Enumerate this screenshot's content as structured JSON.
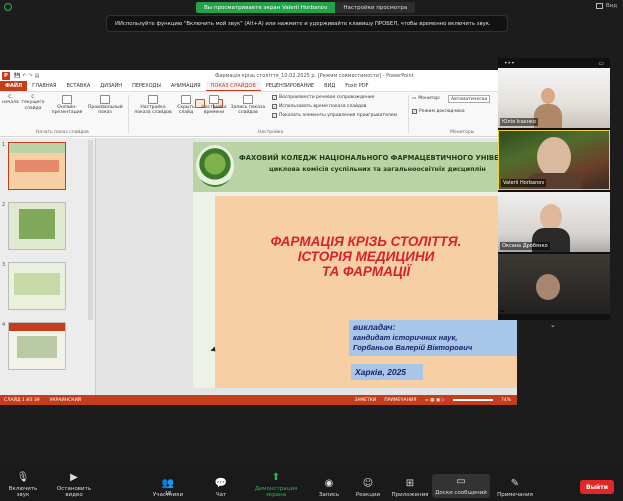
{
  "zoom": {
    "share_banner": "Вы просматриваете экран Valerii Horbanov",
    "view_options": "Настройки просмотра",
    "view_label": "Вид",
    "tooltip": "ИИспользуйте функцию \"Включить мой звук\" (Alt+A) или нажмите и удерживайте клавишу ПРОБЕЛ, чтобы временно включить звук.",
    "participants": [
      {
        "name": "Юлія Ісаєнко"
      },
      {
        "name": "Valerii Horbanov"
      },
      {
        "name": "Оксана Дробязко"
      },
      {
        "name": ""
      }
    ],
    "toolbar": {
      "mute": "Включить звук",
      "video": "Остановить видео",
      "participants": "Участники",
      "participants_count": "18",
      "chat": "Чат",
      "share": "Демонстрация экрана",
      "record": "Запись",
      "reactions": "Реакции",
      "apps": "Приложения",
      "whiteboards": "Доски сообщений",
      "notes": "Примечания",
      "exit": "Выйти"
    },
    "colors": {
      "share_green": "#23a44a",
      "exit_red": "#e02828"
    }
  },
  "ppt": {
    "doc_title": "Фармація крізь століття_10.02.2025 р. [Режим совместимости] - PowerPoint",
    "tabs": [
      "ФАЙЛ",
      "ГЛАВНАЯ",
      "ВСТАВКА",
      "ДИЗАЙН",
      "ПЕРЕХОДЫ",
      "АНИМАЦИЯ",
      "ПОКАЗ СЛАЙДОВ",
      "РЕЦЕНЗИРОВАНИЕ",
      "ВИД",
      "Foxit PDF"
    ],
    "active_tab": "ПОКАЗ СЛАЙДОВ",
    "ribbon": {
      "btn_start": "С начала",
      "btn_current": "С текущего слайда",
      "btn_online": "Онлайн-презентация",
      "btn_custom": "Произвольный показ",
      "group_start": "Начать показ слайдов",
      "btn_setup": "Настройка показа слайдов",
      "btn_hide": "Скрыть слайд",
      "btn_rehearse": "Настройка времени",
      "btn_record": "Запись показа слайдов",
      "chk_narration": "Воспроизвести речевое сопровождение",
      "chk_timings": "Использовать время показа слайдов",
      "chk_controls": "Показать элементы управления проигрывателем",
      "group_setup": "Настройка",
      "monitor_label": "Монитор:",
      "monitor_value": "Автоматически",
      "presenter_view": "Режим докладчика",
      "group_monitors": "Мониторы"
    },
    "thumb_nums": [
      "1",
      "2",
      "3",
      "4"
    ],
    "status": {
      "slide_info": "СЛАЙД 1 ИЗ 39",
      "language": "УКРАИНСКИЙ",
      "notes": "ЗАМЕТКИ",
      "comments": "ПРИМЕЧАНИЯ",
      "zoom": "74%"
    },
    "slide": {
      "header_line1": "ФАХОВИЙ КОЛЕДЖ НАЦІОНАЛЬНОГО ФАРМАЦЕВТИЧНОГО УНІВЕРСИТ",
      "header_line2": "циклова комісія суспільних та загальноосвітніх дисциплін",
      "title_line1": "ФАРМАЦІЯ КРІЗЬ СТОЛІТТЯ.",
      "title_line2": "ІСТОРІЯ МЕДИЦИНИ",
      "title_line3": "ТА ФАРМАЦІЇ",
      "lector_label": "викладач:",
      "lector_degree": "кандидат історичних наук,",
      "lector_name": "Горбаньов Валерій Вікторович",
      "city_year": "Харків, 2025"
    }
  }
}
